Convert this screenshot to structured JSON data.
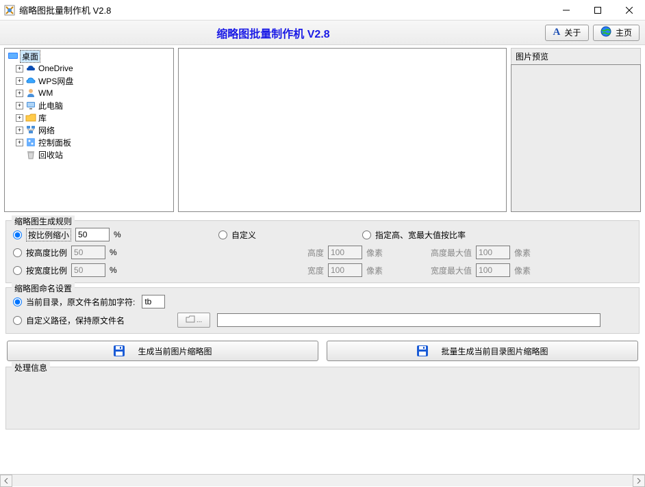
{
  "window": {
    "title": "缩略图批量制作机 V2.8"
  },
  "header": {
    "app_label": "缩略图批量制作机  V2.8",
    "about_label": "关于",
    "home_label": "主页"
  },
  "tree": {
    "root": "桌面",
    "items": [
      {
        "label": "OneDrive",
        "icon": "onedrive"
      },
      {
        "label": "WPS网盘",
        "icon": "wps"
      },
      {
        "label": "WM",
        "icon": "user"
      },
      {
        "label": "此电脑",
        "icon": "pc"
      },
      {
        "label": "库",
        "icon": "lib"
      },
      {
        "label": "网络",
        "icon": "net"
      },
      {
        "label": "控制面板",
        "icon": "ctrl"
      },
      {
        "label": "回收站",
        "icon": "bin",
        "noexpand": true
      }
    ]
  },
  "preview": {
    "title": "图片预览"
  },
  "rules": {
    "legend": "缩略图生成规则",
    "by_ratio": "按比例缩小",
    "by_height": "按高度比例",
    "by_width": "按宽度比例",
    "ratio_val": "50",
    "pct": "%",
    "custom": "自定义",
    "height_label": "高度",
    "width_label": "宽度",
    "px": "像素",
    "h_val": "100",
    "w_val": "100",
    "max_label": "指定高、宽最大值按比率",
    "max_h_label": "高度最大值",
    "max_w_label": "宽度最大值",
    "max_h_val": "100",
    "max_w_val": "100"
  },
  "naming": {
    "legend": "缩略图命名设置",
    "cur_dir": "当前目录，原文件名前加字符:",
    "prefix": "tb",
    "custom_path": "自定义路径，保持原文件名",
    "path_val": ""
  },
  "buttons": {
    "gen_current": "生成当前图片缩略图",
    "gen_batch": "批量生成当前目录图片缩略图"
  },
  "proc": {
    "legend": "处理信息"
  }
}
